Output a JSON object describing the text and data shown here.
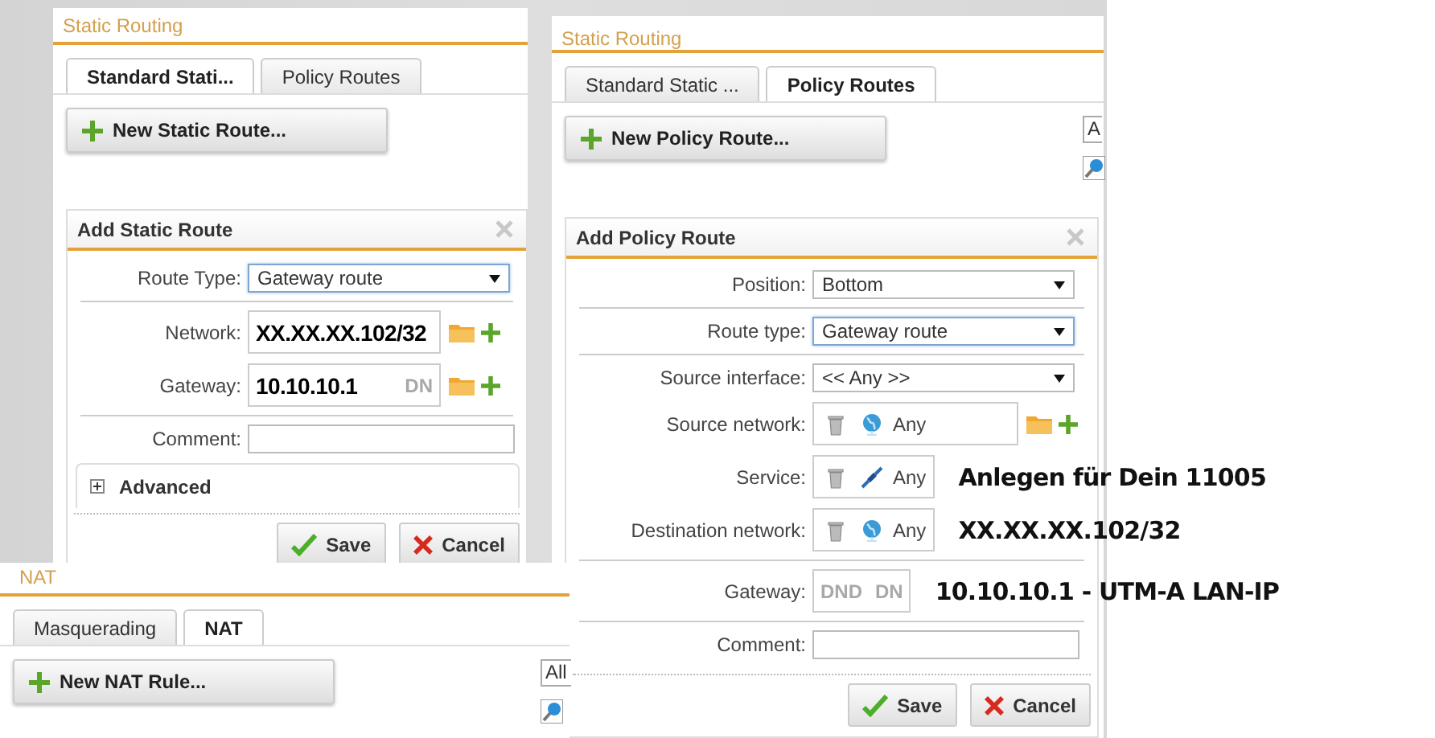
{
  "static_routing_panel": {
    "title": "Static Routing",
    "tabs": [
      {
        "label": "Standard Stati...",
        "selected": true
      },
      {
        "label": "Policy Routes",
        "selected": false
      }
    ],
    "new_button": "New Static Route...",
    "dialog": {
      "title": "Add Static Route",
      "rows": [
        {
          "kind": "select",
          "label": "Route Type:",
          "value": "Gateway route",
          "focused": true
        },
        {
          "kind": "divider"
        },
        {
          "kind": "object",
          "label": "Network:",
          "value": "XX.XX.XX.102/32"
        },
        {
          "kind": "object",
          "label": "Gateway:",
          "value": "10.10.10.1",
          "ghost_text": "DN"
        },
        {
          "kind": "divider"
        },
        {
          "kind": "text",
          "label": "Comment:"
        },
        {
          "kind": "section",
          "label": "Advanced",
          "expanded": false
        }
      ],
      "buttons": [
        "Save",
        "Cancel"
      ]
    }
  },
  "policy_routing_panel": {
    "title": "Static Routing",
    "tabs": [
      {
        "label": "Standard Static ...",
        "selected": false
      },
      {
        "label": "Policy Routes",
        "selected": true
      }
    ],
    "new_button": "New Policy Route...",
    "filter_field": {
      "value": "A"
    },
    "dialog": {
      "title": "Add Policy Route",
      "rows": [
        {
          "kind": "select",
          "label": "Position:",
          "value": "Bottom",
          "focused": false
        },
        {
          "kind": "divider"
        },
        {
          "kind": "select",
          "label": "Route type:",
          "value": "Gateway route",
          "focused": true
        },
        {
          "kind": "divider"
        },
        {
          "kind": "select",
          "label": "Source interface:",
          "value": "<< Any >>",
          "focused": false
        },
        {
          "kind": "network",
          "label": "Source network:",
          "value": "Any"
        },
        {
          "kind": "service",
          "label": "Service:",
          "value": "Any",
          "annotation": "Anlegen für Dein 11005"
        },
        {
          "kind": "network",
          "label": "Destination network:",
          "value": "Any",
          "annotation": "XX.XX.XX.102/32"
        },
        {
          "kind": "divider"
        },
        {
          "kind": "object",
          "label": "Gateway:",
          "placeholder": "DND",
          "ghost_text": "DN",
          "annotation": "10.10.10.1 - UTM-A LAN-IP"
        },
        {
          "kind": "divider"
        },
        {
          "kind": "text",
          "label": "Comment:"
        }
      ],
      "buttons": [
        "Save",
        "Cancel"
      ]
    }
  },
  "nat_panel": {
    "title": "NAT",
    "tabs": [
      {
        "label": "Masquerading",
        "selected": false
      },
      {
        "label": "NAT",
        "selected": true
      }
    ],
    "new_button": "New NAT Rule...",
    "filter_field": {
      "value": "All"
    }
  }
}
